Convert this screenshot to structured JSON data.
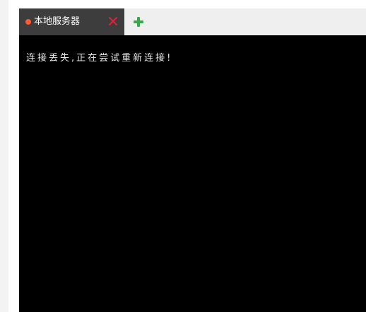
{
  "tabs": [
    {
      "label": "本地服务器",
      "status_icon": "status-dot-icon",
      "status_color": "#ff5a36",
      "close_icon": "close-icon",
      "close_color": "#e0213a"
    }
  ],
  "add_tab_icon": "plus-icon",
  "add_tab_color": "#3aa84a",
  "terminal": {
    "lines": [
      "连接丢失,正在尝试重新连接!"
    ],
    "background": "#000000",
    "text_color": "#e8e8e8"
  }
}
